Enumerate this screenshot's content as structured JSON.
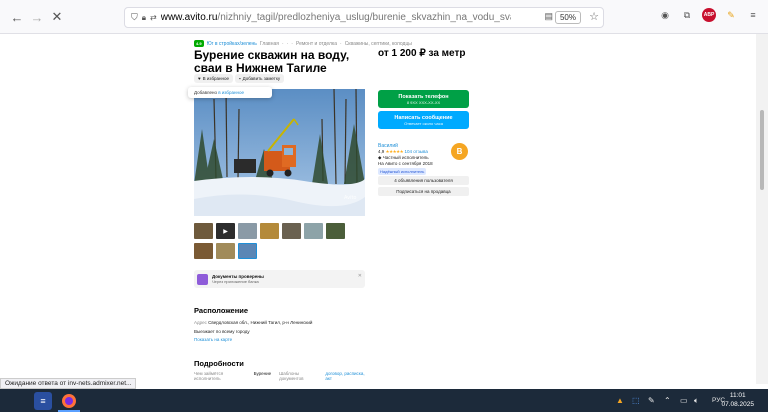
{
  "browser": {
    "url_host": "www.avito.ru",
    "url_path": "/nizhniy_tagil/predlozheniya_uslug/burenie_skvazhin_na_vodu_svai_v_nizhnem_tagile_1439",
    "zoom": "50%"
  },
  "breadcrumb": {
    "badge": "4.9",
    "link": "Юг в стройках/зелень",
    "items": [
      "Главная",
      "·",
      "·",
      "·",
      "Ремонт и отделка",
      "·",
      "Скважины, септики, колодцы"
    ]
  },
  "listing": {
    "title": "Бурение скважин на воду, сваи в Нижнем Тагиле",
    "price": "от 1 200 ₽ за метр",
    "favorite_label": "В избранное",
    "note_label": "Добавить заметку",
    "tooltip_text": "Добавлено ",
    "tooltip_link": "в избранное",
    "photo_watermark": "Avito"
  },
  "docs": {
    "title": "Документы проверены",
    "subtitle": "Через приложение банка"
  },
  "location": {
    "heading": "Расположение",
    "address_label": "Адрес",
    "address_value": "Свердловская обл., Нижний Тагил, р-н Ленинский",
    "travel": "Выезжает по всему городу",
    "map_link": "Показать на карте"
  },
  "details": {
    "heading": "Подробности",
    "rows": [
      {
        "label": "Чем займётся исполнитель",
        "value": "Бурение"
      },
      {
        "label": "Шаблоны документов",
        "value": "договор, расписка, акт"
      }
    ]
  },
  "contact": {
    "phone_title": "Показать телефон",
    "phone_sub": "8 9ХХ ХХХ-ХХ-ХХ",
    "msg_title": "Написать сообщение",
    "msg_sub": "Отвечает около часа",
    "seller_name": "Василий",
    "rating": "4,9",
    "stars": "★★★★★",
    "reviews": "104 отзыва",
    "seller_type": "Частный исполнитель",
    "since": "На Авито с сентября 2018",
    "verified": "Надёжный исполнитель",
    "avatar_letter": "В",
    "more_ads": "4 объявления пользователя",
    "subscribe": "Подписаться на продавца"
  },
  "status_bar": "Ожидание ответа от inv-nets.admixer.net...",
  "taskbar": {
    "lang": "РУС",
    "time": "11:01",
    "date": "07.08.2025"
  },
  "colors": {
    "green": "#00a046",
    "blue": "#00aaff",
    "link": "#1e8fd7",
    "avatar": "#f5a623"
  }
}
